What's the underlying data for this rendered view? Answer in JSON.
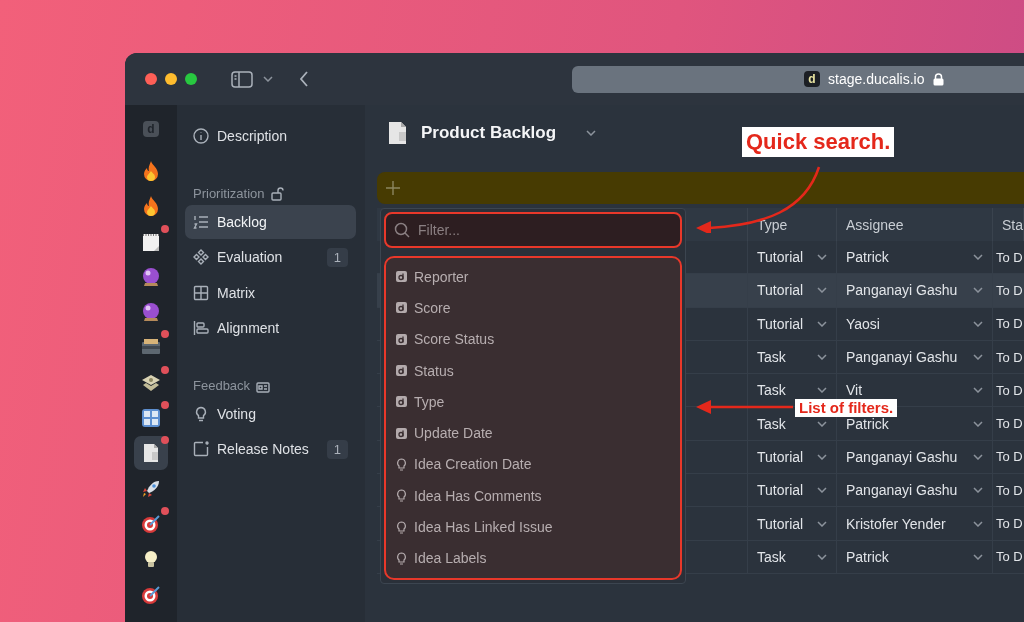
{
  "browser": {
    "favicon": "d",
    "url": "stage.ducalis.io"
  },
  "rail": {
    "logo": "d",
    "items": [
      {
        "kind": "flame",
        "dot": false,
        "selected": false
      },
      {
        "kind": "flame",
        "dot": false,
        "selected": false
      },
      {
        "kind": "notepad",
        "dot": true,
        "selected": false
      },
      {
        "kind": "crystal-ball",
        "dot": false,
        "selected": false
      },
      {
        "kind": "crystal-ball",
        "dot": false,
        "selected": false
      },
      {
        "kind": "card-box",
        "dot": true,
        "selected": false
      },
      {
        "kind": "money",
        "dot": true,
        "selected": false
      },
      {
        "kind": "numbers",
        "dot": true,
        "selected": false
      },
      {
        "kind": "document",
        "dot": true,
        "selected": true
      },
      {
        "kind": "rocket",
        "dot": false,
        "selected": false
      },
      {
        "kind": "target",
        "dot": true,
        "selected": false
      },
      {
        "kind": "bulb",
        "dot": false,
        "selected": false
      },
      {
        "kind": "target",
        "dot": false,
        "selected": false
      }
    ]
  },
  "sidebar": {
    "items": [
      {
        "kind": "item",
        "label": "Description",
        "selected": false
      },
      {
        "kind": "section",
        "label": "Prioritization"
      },
      {
        "kind": "item",
        "label": "Backlog",
        "selected": true
      },
      {
        "kind": "item",
        "label": "Evaluation",
        "badge": "1",
        "selected": false
      },
      {
        "kind": "item",
        "label": "Matrix",
        "selected": false
      },
      {
        "kind": "item",
        "label": "Alignment",
        "selected": false
      },
      {
        "kind": "section",
        "label": "Feedback"
      },
      {
        "kind": "item",
        "label": "Voting",
        "selected": false
      },
      {
        "kind": "item",
        "label": "Release Notes",
        "badge": "1",
        "selected": false
      }
    ]
  },
  "header": {
    "title": "Product Backlog"
  },
  "table": {
    "columns": [
      "Type",
      "Assignee",
      "Sta"
    ],
    "rows": [
      {
        "type": "Tutorial",
        "assignee": "Patrick",
        "status": "To D",
        "selected": false
      },
      {
        "type": "Tutorial",
        "assignee": "Panganayi Gashu",
        "status": "To D",
        "selected": true
      },
      {
        "type": "Tutorial",
        "assignee": "Yaosi",
        "status": "To D",
        "selected": false
      },
      {
        "type": "Task",
        "assignee": "Panganayi Gashu",
        "status": "To D",
        "selected": false
      },
      {
        "type": "Task",
        "assignee": "Vit",
        "status": "To D",
        "selected": false
      },
      {
        "type": "Task",
        "assignee": "Patrick",
        "status": "To D",
        "selected": false
      },
      {
        "type": "Tutorial",
        "assignee": "Panganayi Gashu",
        "status": "To D",
        "selected": false
      },
      {
        "type": "Tutorial",
        "assignee": "Panganayi Gashu",
        "status": "To D",
        "selected": false
      },
      {
        "type": "Tutorial",
        "assignee": "Kristofer Yender",
        "status": "To D",
        "selected": false
      },
      {
        "type": "Task",
        "assignee": "Patrick",
        "status": "To D",
        "selected": false
      }
    ]
  },
  "filter_dropdown": {
    "search": {
      "placeholder": "Filter..."
    },
    "items": [
      {
        "kind": "field",
        "label": "Reporter"
      },
      {
        "kind": "field",
        "label": "Score"
      },
      {
        "kind": "field",
        "label": "Score Status"
      },
      {
        "kind": "field",
        "label": "Status"
      },
      {
        "kind": "field",
        "label": "Type"
      },
      {
        "kind": "field",
        "label": "Update Date"
      },
      {
        "kind": "idea",
        "label": "Idea Creation Date"
      },
      {
        "kind": "idea",
        "label": "Idea Has Comments"
      },
      {
        "kind": "idea",
        "label": "Idea Has Linked Issue"
      },
      {
        "kind": "idea",
        "label": "Idea Labels"
      }
    ]
  },
  "annotations": [
    {
      "text": "Quick search."
    },
    {
      "text": "List of filters."
    }
  ]
}
